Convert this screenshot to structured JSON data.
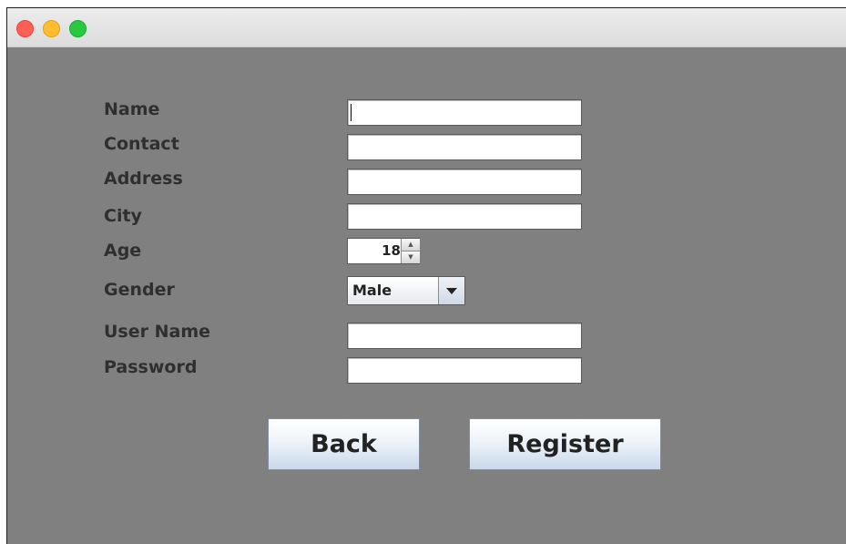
{
  "form": {
    "labels": {
      "name": "Name",
      "contact": "Contact",
      "address": "Address",
      "city": "City",
      "age": "Age",
      "gender": "Gender",
      "username": "User Name",
      "password": "Password"
    },
    "fields": {
      "name": "",
      "contact": "",
      "address": "",
      "city": "",
      "username": "",
      "password": ""
    },
    "age_value": "18",
    "gender_selected": "Male"
  },
  "buttons": {
    "back": "Back",
    "register": "Register"
  },
  "icons": {
    "window_controls": [
      "close-icon",
      "minimize-icon",
      "maximize-icon"
    ],
    "spinner": [
      "spinner-up-icon",
      "spinner-down-icon"
    ],
    "dropdown": "chevron-down-icon"
  },
  "colors": {
    "content_background": "#808080",
    "label_text": "#2f2f2f",
    "close": "#ff5f57",
    "minimize": "#febc2e",
    "maximize": "#28c840"
  }
}
